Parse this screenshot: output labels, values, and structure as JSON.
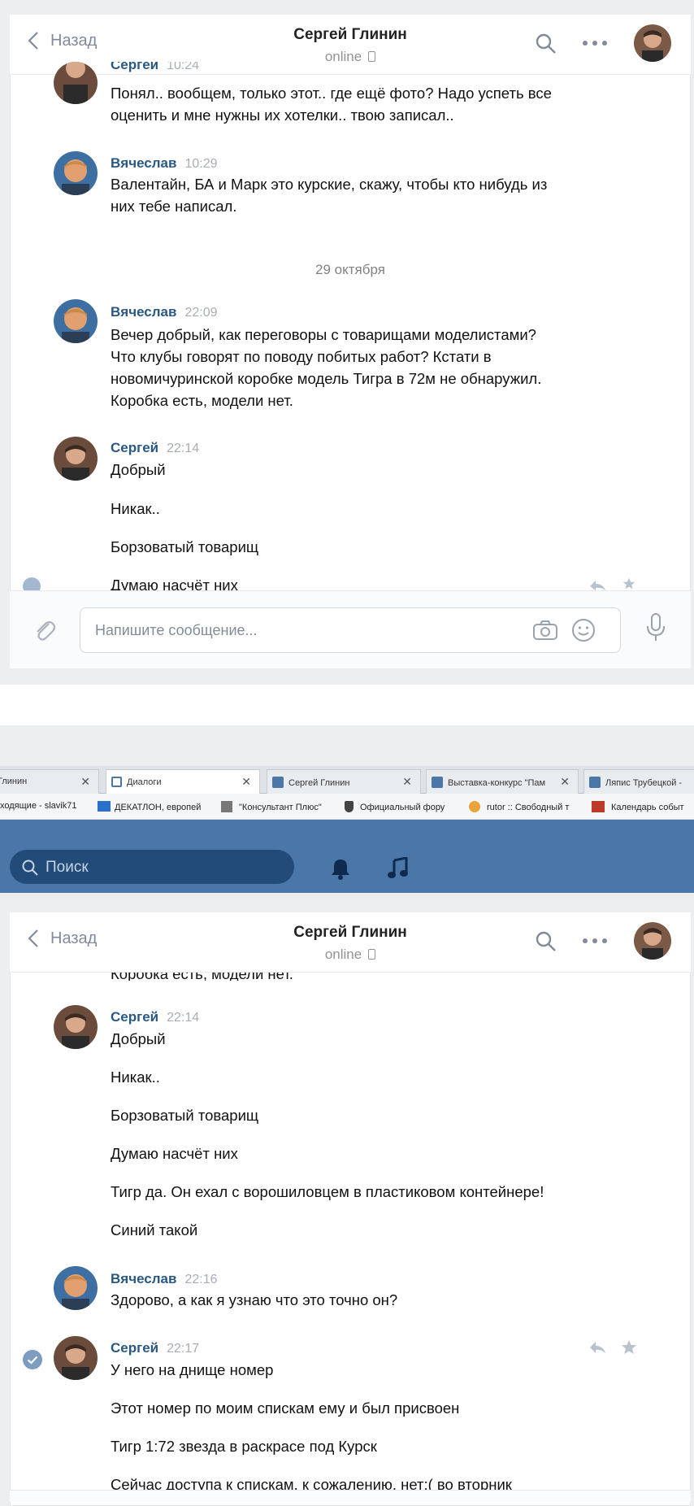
{
  "header": {
    "back_label": "Назад",
    "title": "Сергей Глинин",
    "status": "online"
  },
  "messages_top": [
    {
      "author": "Сергей",
      "time": "10:24",
      "partial": true,
      "lines": [
        "Понял.. вообщем, только этот.. где ещё фото? Надо успеть все",
        "оценить и мне нужны их хотелки.. твою записал.."
      ]
    },
    {
      "author": "Вячеслав",
      "time": "10:29",
      "lines": [
        "Валентайн, БА и Марк это курские, скажу, чтобы кто нибудь из",
        "них тебе написал."
      ]
    },
    {
      "date": "29 октября"
    },
    {
      "author": "Вячеслав",
      "time": "22:09",
      "lines": [
        "Вечер добрый, как переговоры с товарищами моделистами?",
        "Что клубы говорят по поводу побитых работ? Кстати в",
        "новомичуринской коробке модель Тигра в 72м не обнаружил.",
        "Коробка есть, модели нет."
      ]
    },
    {
      "author": "Сергей",
      "time": "22:14",
      "lines": [
        "Добрый"
      ]
    },
    {
      "text": "Никак.."
    },
    {
      "text": "Борзоватый товарищ"
    },
    {
      "text": "Думаю насчёт них"
    }
  ],
  "composer": {
    "placeholder": "Напишите сообщение..."
  },
  "browser": {
    "tabs": [
      "Глинин",
      "Диалоги",
      "Сергей Глинин",
      "Выставка-конкурс \"Пам",
      "Ляпис Трубецкой -"
    ],
    "bookmarks": [
      "ходящие - slavik71",
      "ДЕКАТЛОН, европей",
      "\"Консультант Плюс\"",
      "Официальный фору",
      "rutor :: Свободный т",
      "Календарь событ"
    ],
    "search_placeholder": "Поиск"
  },
  "header2": {
    "back_label": "Назад",
    "title": "Сергей Глинин",
    "status": "online",
    "cut_line": "Коробка есть, модели нет."
  },
  "messages_bottom": [
    {
      "author": "Сергей",
      "time": "22:14",
      "lines": [
        "Добрый"
      ]
    },
    {
      "text": "Никак.."
    },
    {
      "text": "Борзоватый товарищ"
    },
    {
      "text": "Думаю насчёт них"
    },
    {
      "text": "Тигр да. Он ехал с ворошиловцем в пластиковом контейнере!"
    },
    {
      "text": "Синий такой"
    },
    {
      "author": "Вячеслав",
      "time": "22:16",
      "lines": [
        "Здорово, а как я узнаю что это точно он?"
      ]
    },
    {
      "author": "Сергей",
      "time": "22:17",
      "lines": [
        "У него на днище номер"
      ]
    },
    {
      "text": "Этот номер по моим спискам ему и был присвоен"
    },
    {
      "text": "Тигр 1:72 звезда в раскрасе под Курск"
    },
    {
      "text": "Сейчас доступа к спискам, к сожалению, нет:( во вторник"
    }
  ],
  "colors": {
    "accent": "#2a5885",
    "vk_blue": "#4a76a8",
    "muted": "#828a99"
  }
}
